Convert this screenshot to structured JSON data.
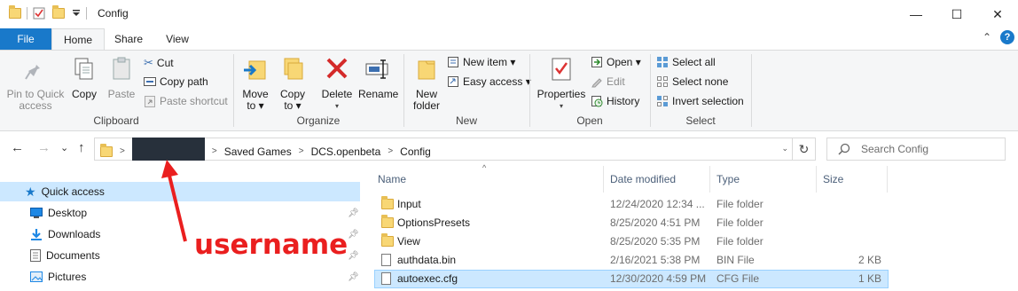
{
  "window": {
    "title": "Config",
    "minimize": "—",
    "maximize": "☐",
    "close": "✕"
  },
  "ribbon_tabs": {
    "file": "File",
    "home": "Home",
    "share": "Share",
    "view": "View",
    "collapse": "⌃",
    "help": "?"
  },
  "clipboard": {
    "label": "Clipboard",
    "pin_to_quick_access": [
      "Pin to Quick",
      "access"
    ],
    "copy": "Copy",
    "paste": "Paste",
    "cut": "Cut",
    "copy_path": "Copy path",
    "paste_shortcut": "Paste shortcut"
  },
  "organize": {
    "label": "Organize",
    "move_to": [
      "Move",
      "to ▾"
    ],
    "copy_to": [
      "Copy",
      "to ▾"
    ],
    "delete": [
      "Delete",
      "▾"
    ],
    "rename": "Rename"
  },
  "new": {
    "label": "New",
    "new_folder": [
      "New",
      "folder"
    ],
    "new_item": "New item ▾",
    "easy_access": "Easy access ▾"
  },
  "open": {
    "label": "Open",
    "properties": [
      "Properties",
      "▾"
    ],
    "open": "Open ▾",
    "edit": "Edit",
    "history": "History"
  },
  "select": {
    "label": "Select",
    "select_all": "Select all",
    "select_none": "Select none",
    "invert_selection": "Invert selection"
  },
  "address": {
    "back": "←",
    "forward": "→",
    "recent": "⌄",
    "up": "↑",
    "crumbs": [
      "Saved Games",
      "DCS.openbeta",
      "Config"
    ],
    "dropdown": "⌄",
    "refresh": "↻",
    "search_placeholder": "Search Config"
  },
  "nav_pane": {
    "items": [
      {
        "label": "Quick access",
        "icon": "star-icon"
      },
      {
        "label": "Desktop",
        "icon": "desktop-icon"
      },
      {
        "label": "Downloads",
        "icon": "download-icon"
      },
      {
        "label": "Documents",
        "icon": "documents-icon"
      },
      {
        "label": "Pictures",
        "icon": "pictures-icon"
      }
    ]
  },
  "annotation": {
    "text": "username",
    "color": "#ea1f1f"
  },
  "columns": {
    "name": "Name",
    "date_modified": "Date modified",
    "type": "Type",
    "size": "Size"
  },
  "files": [
    {
      "name": "Input",
      "date": "12/24/2020 12:34 ...",
      "type": "File folder",
      "size": "",
      "icon": "folder-icon"
    },
    {
      "name": "OptionsPresets",
      "date": "8/25/2020 4:51 PM",
      "type": "File folder",
      "size": "",
      "icon": "folder-icon"
    },
    {
      "name": "View",
      "date": "8/25/2020 5:35 PM",
      "type": "File folder",
      "size": "",
      "icon": "folder-icon"
    },
    {
      "name": "authdata.bin",
      "date": "2/16/2021 5:38 PM",
      "type": "BIN File",
      "size": "2 KB",
      "icon": "file-icon"
    },
    {
      "name": "autoexec.cfg",
      "date": "12/30/2020 4:59 PM",
      "type": "CFG File",
      "size": "1 KB",
      "icon": "file-icon"
    }
  ],
  "colors": {
    "accent": "#1979ca",
    "selection": "#cce8ff",
    "ribbon_bg": "#f5f6f7"
  }
}
